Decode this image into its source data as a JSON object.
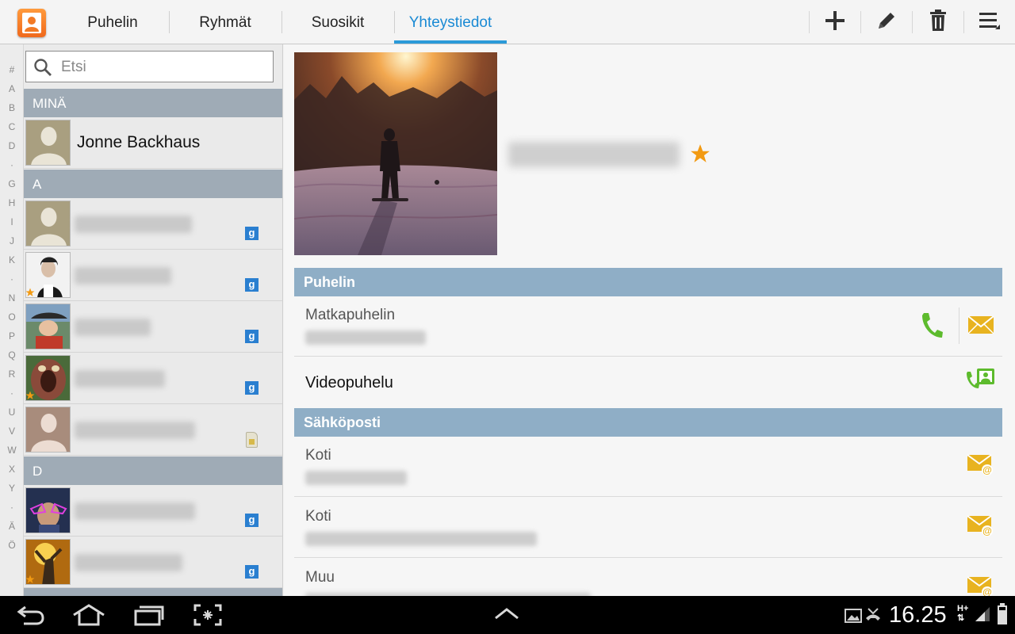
{
  "tabs": [
    {
      "label": "Puhelin",
      "active": false
    },
    {
      "label": "Ryhmät",
      "active": false
    },
    {
      "label": "Suosikit",
      "active": false
    },
    {
      "label": "Yhteystiedot",
      "active": true
    }
  ],
  "actions": [
    "add-icon",
    "edit-icon",
    "delete-icon",
    "menu-icon"
  ],
  "index_letters": [
    "#",
    "A",
    "B",
    "C",
    "D",
    "·",
    "G",
    "H",
    "I",
    "J",
    "K",
    "·",
    "N",
    "O",
    "P",
    "Q",
    "R",
    "·",
    "U",
    "V",
    "W",
    "X",
    "Y",
    "·",
    "Ä",
    "Ö"
  ],
  "search": {
    "placeholder": "Etsi",
    "value": ""
  },
  "list": {
    "me_header": "MINÄ",
    "me_name": "Jonne Backhaus",
    "section_a": "A",
    "section_d": "D"
  },
  "detail": {
    "favorite": true,
    "phone_section": "Puhelin",
    "mobile_label": "Matkapuhelin",
    "video_label": "Videopuhelu",
    "email_section": "Sähköposti",
    "email_home_1": "Koti",
    "email_home_2": "Koti",
    "email_other": "Muu"
  },
  "status": {
    "time": "16.25",
    "network": "H+"
  },
  "colors": {
    "accent": "#2b9ad8",
    "section": "#8faec6",
    "call_green": "#5dbb2d",
    "mail_yellow": "#e8b320",
    "favorite_star": "#f29a12",
    "google_badge": "#2a7fd0"
  }
}
